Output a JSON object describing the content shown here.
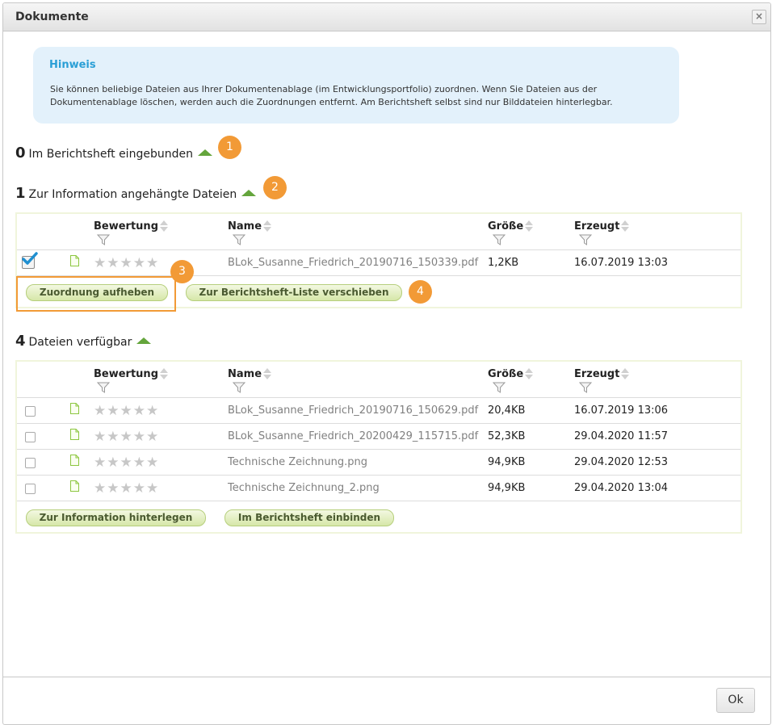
{
  "dialog": {
    "title": "Dokumente",
    "close_label": "×",
    "ok_label": "Ok"
  },
  "hint": {
    "title": "Hinweis",
    "text": "Sie können beliebige Dateien aus Ihrer Dokumentenablage (im Entwicklungsportfolio) zuordnen. Wenn Sie Dateien aus der Dokumentenablage löschen, werden auch die Zuordnungen entfernt. Am Berichtsheft selbst sind nur Bilddateien hinterlegbar."
  },
  "sections": {
    "embedded": {
      "count": "0",
      "label": "Im Berichtsheft eingebunden",
      "badge": "1"
    },
    "attached": {
      "count": "1",
      "label": "Zur Information angehängte Dateien",
      "badge": "2"
    },
    "available": {
      "count": "4",
      "label": "Dateien verfügbar"
    }
  },
  "columns": {
    "rating": "Bewertung",
    "name": "Name",
    "size": "Größe",
    "created": "Erzeugt"
  },
  "attached_table": {
    "rows": [
      {
        "checked": true,
        "stars": "★★★★★",
        "name": "BLok_Susanne_Friedrich_20190716_150339.pdf",
        "size": "1,2KB",
        "created": "16.07.2019 13:03"
      }
    ],
    "buttons": {
      "remove": "Zuordnung aufheben",
      "move": "Zur Berichtsheft-Liste verschieben"
    },
    "badges": {
      "remove": "3",
      "move": "4"
    }
  },
  "available_table": {
    "rows": [
      {
        "checked": false,
        "stars": "★★★★★",
        "name": "BLok_Susanne_Friedrich_20190716_150629.pdf",
        "size": "20,4KB",
        "created": "16.07.2019 13:06"
      },
      {
        "checked": false,
        "stars": "★★★★★",
        "name": "BLok_Susanne_Friedrich_20200429_115715.pdf",
        "size": "52,3KB",
        "created": "29.04.2020 11:57"
      },
      {
        "checked": false,
        "stars": "★★★★★",
        "name": "Technische Zeichnung.png",
        "size": "94,9KB",
        "created": "29.04.2020 12:53"
      },
      {
        "checked": false,
        "stars": "★★★★★",
        "name": "Technische Zeichnung_2.png",
        "size": "94,9KB",
        "created": "29.04.2020 13:04"
      }
    ],
    "buttons": {
      "info": "Zur Information hinterlegen",
      "embed": "Im Berichtsheft einbinden"
    }
  },
  "colors": {
    "accent_orange": "#f29a36",
    "arrow_green": "#64a53c",
    "hint_bg": "#e3f1fb",
    "hint_title": "#2a9fd6"
  }
}
